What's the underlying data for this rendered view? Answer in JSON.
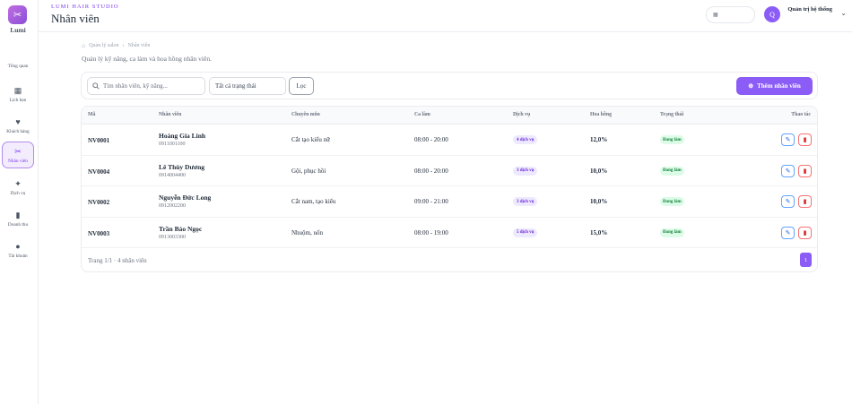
{
  "sidebar": {
    "logo_text": "Lumi",
    "items": [
      {
        "label": "Tổng quan",
        "icon": "dashboard-icon"
      },
      {
        "label": "Lịch hẹn",
        "icon": "calendar-icon"
      },
      {
        "label": "Khách hàng",
        "icon": "heart-icon"
      },
      {
        "label": "Nhân viên",
        "icon": "scissors-icon",
        "active": true
      },
      {
        "label": "Dịch vụ",
        "icon": "magic-wand-icon"
      },
      {
        "label": "Doanh thu",
        "icon": "bar-chart-icon"
      },
      {
        "label": "Tài khoản",
        "icon": "user-gear-icon"
      }
    ]
  },
  "header": {
    "brand": "LUMI HAIR STUDIO",
    "title": "Nhân viên",
    "user_initial": "Q",
    "user_name": "Quản trị hệ thống"
  },
  "breadcrumb": {
    "root": "Quản lý salon",
    "current": "Nhân viên"
  },
  "subtitle": "Quản lý kỹ năng, ca làm và hoa hồng nhân viên.",
  "toolbar": {
    "search_placeholder": "Tìm nhân viên, kỹ năng...",
    "status_filter": "Tất cả trạng thái",
    "filter_label": "Lọc",
    "add_label": "Thêm nhân viên"
  },
  "table": {
    "headers": {
      "code": "Mã",
      "name": "Nhân viên",
      "specialty": "Chuyên môn",
      "shift": "Ca làm",
      "services": "Dịch vụ",
      "commission": "Hoa hồng",
      "status": "Trạng thái",
      "actions": "Thao tác"
    },
    "rows": [
      {
        "code": "NV0001",
        "name": "Hoàng Gia Linh",
        "phone": "0911001100",
        "specialty": "Cắt tạo kiểu nữ",
        "shift": "08:00 - 20:00",
        "services": "4 dịch vụ",
        "commission": "12,0%",
        "status": "Đang làm"
      },
      {
        "code": "NV0004",
        "name": "Lê Thùy Dương",
        "phone": "0914004400",
        "specialty": "Gội, phục hồi",
        "shift": "08:00 - 20:00",
        "services": "3 dịch vụ",
        "commission": "10,0%",
        "status": "Đang làm"
      },
      {
        "code": "NV0002",
        "name": "Nguyễn Đức Long",
        "phone": "0912002200",
        "specialty": "Cắt nam, tạo kiểu",
        "shift": "09:00 - 21:00",
        "services": "3 dịch vụ",
        "commission": "10,0%",
        "status": "Đang làm"
      },
      {
        "code": "NV0003",
        "name": "Trần Bảo Ngọc",
        "phone": "0913003300",
        "specialty": "Nhuộm, uốn",
        "shift": "08:00 - 19:00",
        "services": "5 dịch vụ",
        "commission": "15,0%",
        "status": "Đang làm"
      }
    ],
    "footer": "Trang 1/1 · 4 nhân viên",
    "current_page": "1"
  },
  "colors": {
    "accent": "#8b5cf6",
    "success": "#15803d",
    "danger": "#dc2626",
    "edit": "#2563eb"
  }
}
